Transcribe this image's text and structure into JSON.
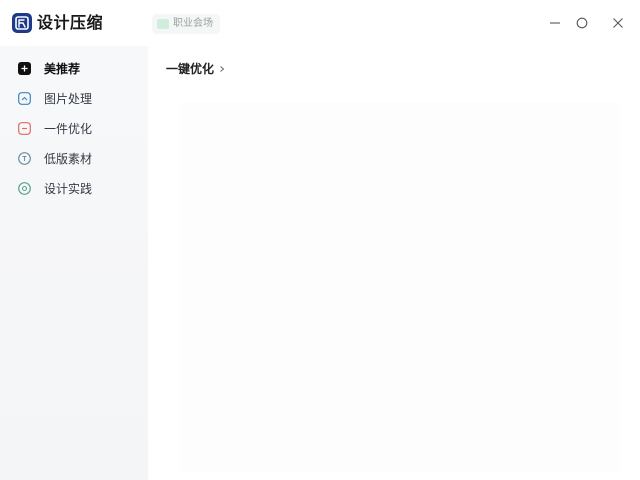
{
  "app": {
    "title": "设计压缩",
    "logo_icon": "app-logo-icon",
    "brand_color": "#1f3a8a"
  },
  "header": {
    "badge_label": "职业会场",
    "badge_icon": "vip-icon"
  },
  "window_controls": {
    "minimize_icon": "minimize-icon",
    "maximize_icon": "maximize-icon",
    "close_icon": "close-icon"
  },
  "sidebar": {
    "items": [
      {
        "label": "美推荐",
        "icon": "recommend-icon",
        "active": true,
        "color": "#111111"
      },
      {
        "label": "图片处理",
        "icon": "image-process-icon",
        "active": false,
        "color": "#3b82c4"
      },
      {
        "label": "一件优化",
        "icon": "optimize-icon",
        "active": false,
        "color": "#e06a5f"
      },
      {
        "label": "低版素材",
        "icon": "material-icon",
        "active": false,
        "color": "#6c8fa6"
      },
      {
        "label": "设计实践",
        "icon": "practice-icon",
        "active": false,
        "color": "#5aa58b"
      }
    ]
  },
  "main": {
    "breadcrumb": "一键优化",
    "breadcrumb_icon": "chevron-right-icon"
  }
}
